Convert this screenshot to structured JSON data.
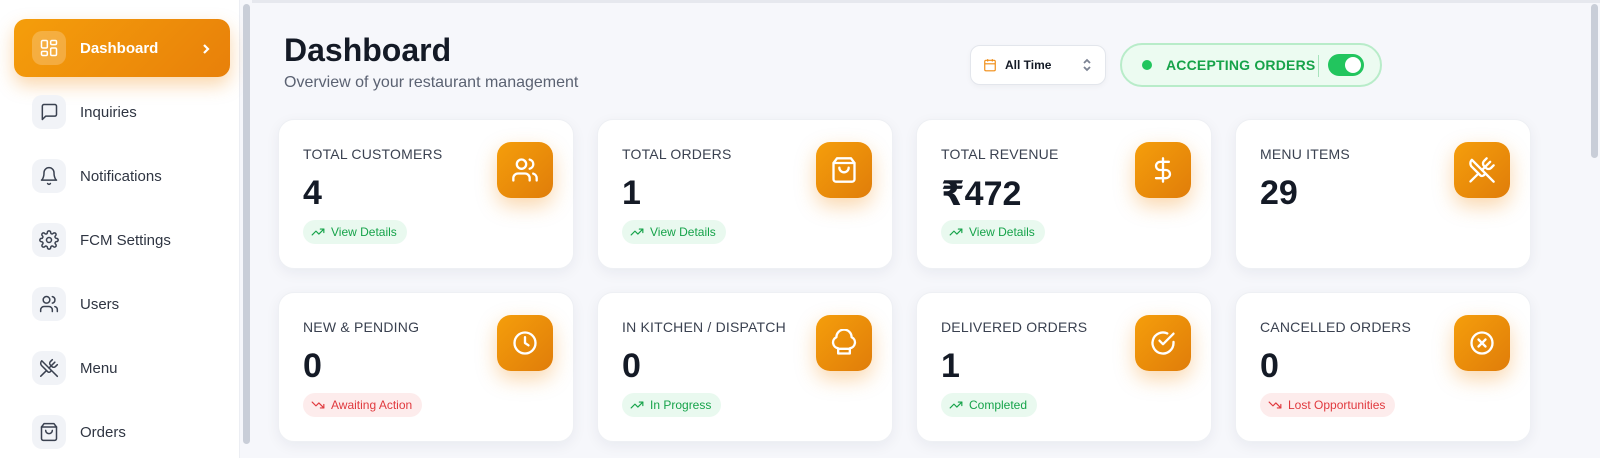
{
  "sidebar": {
    "items": [
      {
        "label": "Dashboard",
        "icon": "dashboard-icon",
        "active": true
      },
      {
        "label": "Inquiries",
        "icon": "message-icon"
      },
      {
        "label": "Notifications",
        "icon": "bell-icon"
      },
      {
        "label": "FCM Settings",
        "icon": "gear-icon"
      },
      {
        "label": "Users",
        "icon": "users-icon"
      },
      {
        "label": "Menu",
        "icon": "utensils-crossed-icon"
      },
      {
        "label": "Orders",
        "icon": "shopping-bag-icon"
      }
    ]
  },
  "header": {
    "title": "Dashboard",
    "subtitle": "Overview of your restaurant management",
    "time_filter": "All Time",
    "accepting_label": "ACCEPTING ORDERS",
    "accepting_on": true
  },
  "stats": [
    {
      "label": "TOTAL CUSTOMERS",
      "value": "4",
      "icon": "users-icon",
      "badge": "View Details",
      "badge_type": "green"
    },
    {
      "label": "TOTAL ORDERS",
      "value": "1",
      "icon": "shopping-bag-icon",
      "badge": "View Details",
      "badge_type": "green"
    },
    {
      "label": "TOTAL REVENUE",
      "value": "₹472",
      "icon": "dollar-icon",
      "badge": "View Details",
      "badge_type": "green"
    },
    {
      "label": "MENU ITEMS",
      "value": "29",
      "icon": "utensils-crossed-icon",
      "badge": "",
      "badge_type": ""
    },
    {
      "label": "NEW & PENDING",
      "value": "0",
      "icon": "clock-icon",
      "badge": "Awaiting Action",
      "badge_type": "red"
    },
    {
      "label": "IN KITCHEN / DISPATCH",
      "value": "0",
      "icon": "chef-hat-icon",
      "badge": "In Progress",
      "badge_type": "green"
    },
    {
      "label": "DELIVERED ORDERS",
      "value": "1",
      "icon": "check-circle-icon",
      "badge": "Completed",
      "badge_type": "green"
    },
    {
      "label": "CANCELLED ORDERS",
      "value": "0",
      "icon": "x-circle-icon",
      "badge": "Lost Opportunities",
      "badge_type": "red"
    }
  ],
  "colors": {
    "accent": "#f08c14",
    "success": "#16a34a",
    "danger": "#e0393e"
  }
}
